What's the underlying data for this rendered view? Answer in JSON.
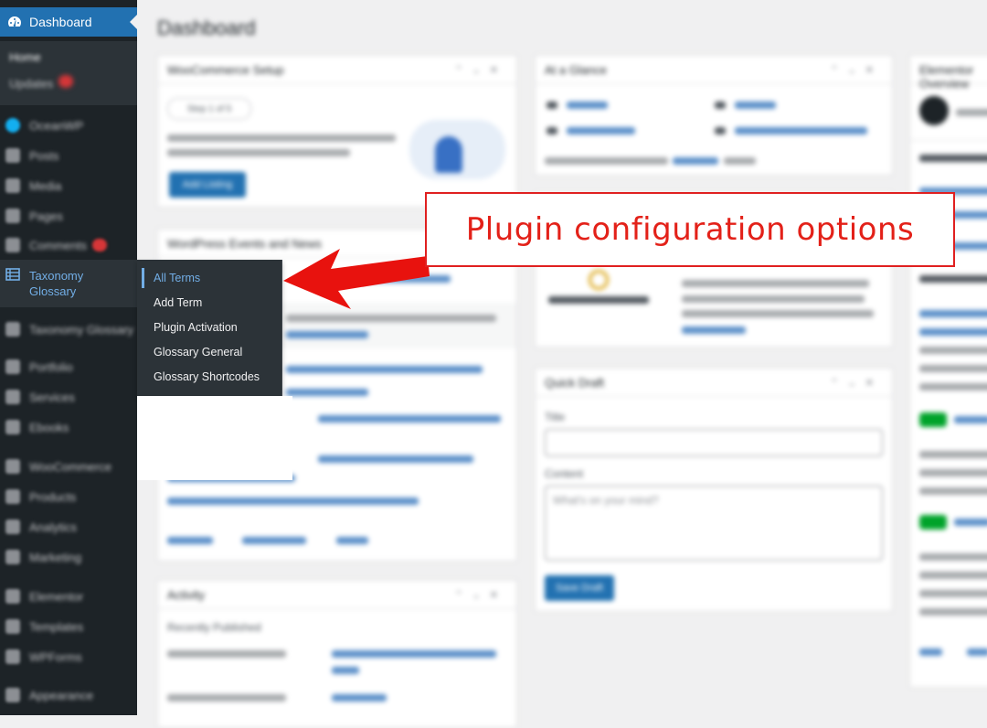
{
  "sidebar": {
    "active_label": "Dashboard",
    "sub_items": [
      "Home",
      "Updates"
    ],
    "items": [
      {
        "label": "OceanWP",
        "badge": false
      },
      {
        "label": "Posts",
        "badge": false
      },
      {
        "label": "Media",
        "badge": false
      },
      {
        "label": "Pages",
        "badge": false
      },
      {
        "label": "Comments",
        "badge": true
      },
      {
        "label": "Taxonomy Glossary",
        "badge": false
      },
      {
        "label": "Portfolio",
        "badge": false
      },
      {
        "label": "Services",
        "badge": false
      },
      {
        "label": "Ebooks",
        "badge": false
      },
      {
        "label": "WooCommerce",
        "badge": false
      },
      {
        "label": "Products",
        "badge": false
      },
      {
        "label": "Analytics",
        "badge": false
      },
      {
        "label": "Marketing",
        "badge": false
      },
      {
        "label": "Elementor",
        "badge": false
      },
      {
        "label": "Templates",
        "badge": false
      },
      {
        "label": "WPForms",
        "badge": false
      },
      {
        "label": "Appearance",
        "badge": false
      }
    ],
    "glossary_label": "Taxonomy Glossary"
  },
  "flyout": {
    "items": [
      "All Terms",
      "Add Term",
      "Plugin Activation",
      "Glossary General",
      "Glossary Shortcodes"
    ],
    "current": "All Terms"
  },
  "main": {
    "title": "Dashboard",
    "cards": {
      "woocommerce_setup": {
        "title": "WooCommerce Setup",
        "step": "Step 1 of 5",
        "button": "Add Listing"
      },
      "at_a_glance": {
        "title": "At a Glance"
      },
      "events_news": {
        "title": "WordPress Events and News"
      },
      "quick_draft": {
        "title": "Quick Draft",
        "title_label": "Title",
        "content_label": "Content",
        "content_placeholder": "What's on your mind?",
        "button": "Save Draft"
      },
      "activity": {
        "title": "Activity",
        "subtitle": "Recently Published"
      },
      "elementor": {
        "title": "Elementor Overview"
      }
    }
  },
  "annotation": {
    "text": "Plugin configuration options",
    "color": "#e32119"
  }
}
